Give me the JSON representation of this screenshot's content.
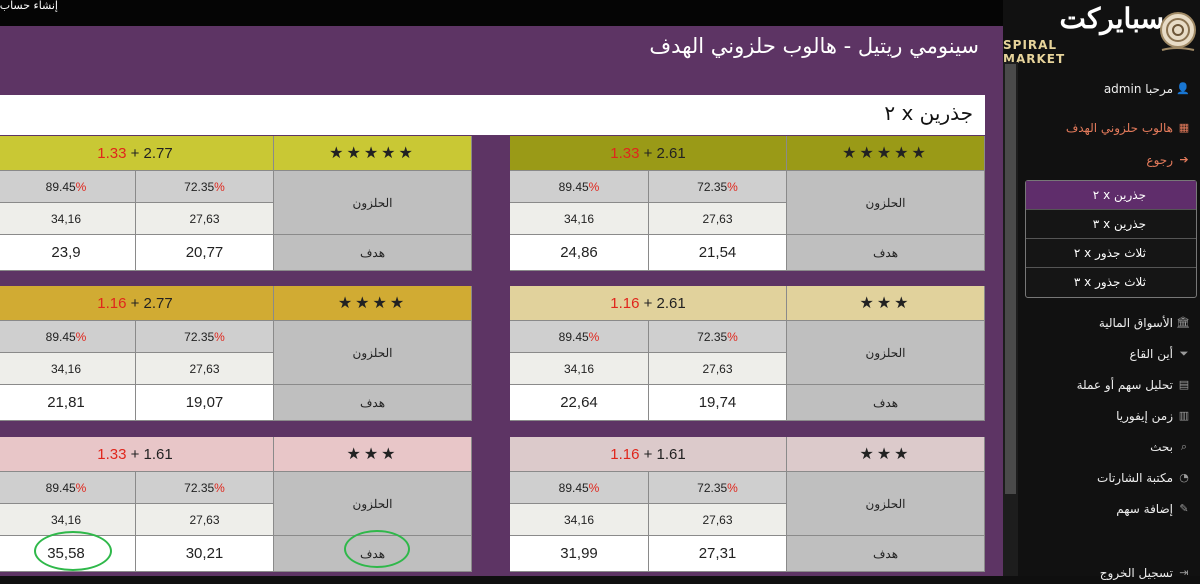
{
  "topbar": {
    "signup_label": "إنشاء حساب"
  },
  "logo": {
    "arabic": "سبايركت",
    "english": "SPIRAL MARKET"
  },
  "sidebar": {
    "greeting": "مرحبا admin",
    "items": [
      {
        "label": "هالوب حلزوني الهدف",
        "icon": "table-icon"
      },
      {
        "label": "رجوع",
        "icon": "back-arrow-icon"
      },
      {
        "label": "الأسواق المالية",
        "icon": "bank-icon"
      },
      {
        "label": "أين القاع",
        "icon": "filter-icon"
      },
      {
        "label": "تحليل سهم أو عملة",
        "icon": "calculator-icon"
      },
      {
        "label": "زمن إيفوريا",
        "icon": "calendar-icon"
      },
      {
        "label": "بحث",
        "icon": "search-icon"
      },
      {
        "label": "مكتبة الشارتات",
        "icon": "pie-chart-icon"
      },
      {
        "label": "إضافة سهم",
        "icon": "edit-icon"
      },
      {
        "label": "تسجيل الخروج",
        "icon": "logout-icon"
      }
    ],
    "submenu": [
      "جذرين x ٢",
      "جذرين x ٣",
      "ثلاث جذور x ٢",
      "ثلاث جذور x ٣"
    ]
  },
  "main": {
    "title": "سينومي ريتيل - هالوب حلزوني الهدف",
    "panel_title": "جذرين x ٢",
    "label_snail": "الحلزون",
    "label_target": "هدف",
    "pct1": "72.35",
    "pct2": "89.45",
    "pct_sign": "%",
    "val1": "27,63",
    "val2": "34,16",
    "cards": [
      {
        "stars": "★★★★★",
        "base": "2.61",
        "add": "1.33",
        "t1": "21,54",
        "t2": "24,86",
        "head_color": "#9a9a17"
      },
      {
        "stars": "★★★★★",
        "base": "2.77",
        "add": "1.33",
        "t1": "20,77",
        "t2": "23,9",
        "head_color": "#c9c834"
      },
      {
        "stars": "★★★",
        "base": "2.61",
        "add": "1.16",
        "t1": "19,74",
        "t2": "22,64",
        "head_color": "#e1d29c"
      },
      {
        "stars": "★★★★",
        "base": "2.77",
        "add": "1.16",
        "t1": "19,07",
        "t2": "21,81",
        "head_color": "#d1ab33"
      },
      {
        "stars": "★★★",
        "base": "1.61",
        "add": "1.16",
        "t1": "27,31",
        "t2": "31,99",
        "head_color": "#dccacb"
      },
      {
        "stars": "★★★",
        "base": "1.61",
        "add": "1.33",
        "t1": "30,21",
        "t2": "35,58",
        "head_color": "#e8c6c8"
      }
    ]
  }
}
